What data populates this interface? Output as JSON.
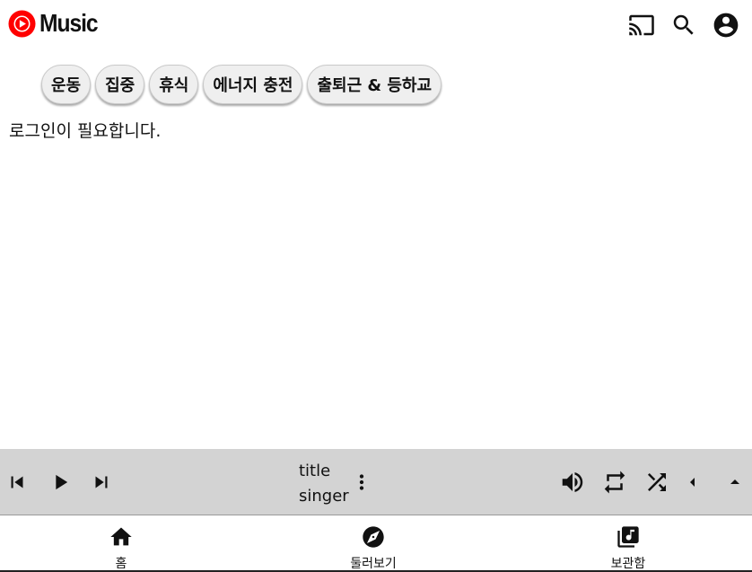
{
  "app": {
    "logo_text": "Music",
    "brand_color": "#ff0000"
  },
  "header": {
    "icons": [
      "cast-icon",
      "search-icon",
      "account-icon"
    ]
  },
  "chips": [
    {
      "label": "운동"
    },
    {
      "label": "집중"
    },
    {
      "label": "휴식"
    },
    {
      "label": "에너지 충전"
    },
    {
      "label": "출퇴근 & 등하교"
    }
  ],
  "main": {
    "message": "로그인이 필요합니다."
  },
  "player": {
    "title": "title",
    "artist": "singer",
    "background": "#d3d3d3",
    "controls": [
      "skip-previous-icon",
      "play-icon",
      "skip-next-icon",
      "more-vert-icon",
      "volume-icon",
      "repeat-icon",
      "shuffle-icon",
      "arrow-left-icon",
      "arrow-up-icon"
    ]
  },
  "nav": [
    {
      "label": "홈",
      "icon": "home-icon"
    },
    {
      "label": "둘러보기",
      "icon": "explore-icon"
    },
    {
      "label": "보관함",
      "icon": "library-music-icon"
    }
  ]
}
